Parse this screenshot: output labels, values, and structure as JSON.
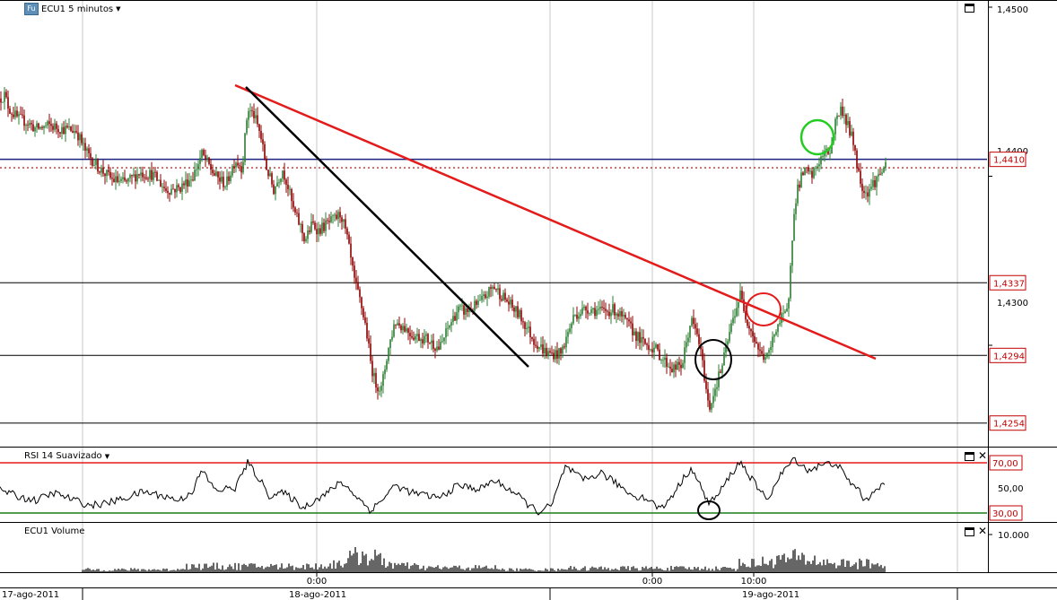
{
  "panels": {
    "price": {
      "title": "ECU1 5 minutos",
      "badge": "Fu"
    },
    "rsi": {
      "title": "RSI 14 Suavizado"
    },
    "volume": {
      "title": "ECU1 Volume"
    }
  },
  "icons": {
    "window": "maximize-icon",
    "close": "close-icon",
    "dropdown": "chevron-down-icon"
  },
  "colors": {
    "up": "#2e7d32",
    "down": "#8b0000",
    "red_line": "#e31b1b",
    "blue_line": "#1a237e",
    "green_line": "#1b7d1b"
  },
  "x_axis": {
    "dates": [
      "17-ago-2011",
      "18-ago-2011",
      "19-ago-2011"
    ],
    "times": [
      "0:00",
      "0:00",
      "10:00"
    ]
  },
  "chart_data": [
    {
      "type": "candlestick",
      "title": "ECU1 5 minutos",
      "ylim": [
        1.421,
        1.4505
      ],
      "y_tick_labels": [
        "1,4500",
        "1,4300",
        "1,4400"
      ],
      "price_levels": [
        {
          "value": 1.441,
          "label": "1,4410",
          "color": "#1a237e"
        },
        {
          "value": 1.4337,
          "label": "1,4337",
          "color": "#000000"
        },
        {
          "value": 1.4294,
          "label": "1,4294",
          "color": "#000000"
        },
        {
          "value": 1.4254,
          "label": "1,4254",
          "color": "#000000"
        }
      ],
      "close_path": [
        [
          0,
          1.4446
        ],
        [
          5,
          1.4448
        ],
        [
          10,
          1.444
        ],
        [
          20,
          1.4434
        ],
        [
          30,
          1.4432
        ],
        [
          40,
          1.4428
        ],
        [
          55,
          1.443
        ],
        [
          70,
          1.4428
        ],
        [
          85,
          1.4427
        ],
        [
          95,
          1.4415
        ],
        [
          110,
          1.4405
        ],
        [
          125,
          1.4398
        ],
        [
          140,
          1.4396
        ],
        [
          155,
          1.4402
        ],
        [
          170,
          1.4401
        ],
        [
          185,
          1.4392
        ],
        [
          200,
          1.4393
        ],
        [
          215,
          1.44
        ],
        [
          225,
          1.4413
        ],
        [
          240,
          1.44
        ],
        [
          252,
          1.4395
        ],
        [
          262,
          1.441
        ],
        [
          270,
          1.4405
        ],
        [
          276,
          1.444
        ],
        [
          283,
          1.4436
        ],
        [
          290,
          1.4425
        ],
        [
          297,
          1.4405
        ],
        [
          305,
          1.4392
        ],
        [
          315,
          1.4404
        ],
        [
          320,
          1.4396
        ],
        [
          327,
          1.438
        ],
        [
          335,
          1.437
        ],
        [
          340,
          1.4362
        ],
        [
          348,
          1.4372
        ],
        [
          355,
          1.4368
        ],
        [
          365,
          1.4372
        ],
        [
          372,
          1.4374
        ],
        [
          380,
          1.4378
        ],
        [
          387,
          1.4363
        ],
        [
          395,
          1.4338
        ],
        [
          402,
          1.4325
        ],
        [
          408,
          1.431
        ],
        [
          413,
          1.429
        ],
        [
          418,
          1.4278
        ],
        [
          425,
          1.4274
        ],
        [
          432,
          1.4296
        ],
        [
          440,
          1.4314
        ],
        [
          450,
          1.4311
        ],
        [
          460,
          1.4306
        ],
        [
          475,
          1.4304
        ],
        [
          490,
          1.4298
        ],
        [
          500,
          1.4311
        ],
        [
          510,
          1.4321
        ],
        [
          520,
          1.432
        ],
        [
          535,
          1.4325
        ],
        [
          550,
          1.4335
        ],
        [
          565,
          1.4326
        ],
        [
          580,
          1.4317
        ],
        [
          595,
          1.4303
        ],
        [
          610,
          1.4295
        ],
        [
          625,
          1.4295
        ],
        [
          640,
          1.4318
        ],
        [
          655,
          1.4322
        ],
        [
          670,
          1.432
        ],
        [
          685,
          1.4321
        ],
        [
          700,
          1.4312
        ],
        [
          715,
          1.4302
        ],
        [
          730,
          1.4298
        ],
        [
          740,
          1.4291
        ],
        [
          750,
          1.4286
        ],
        [
          760,
          1.4288
        ],
        [
          770,
          1.4315
        ],
        [
          778,
          1.4305
        ],
        [
          785,
          1.4282
        ],
        [
          790,
          1.4262
        ],
        [
          797,
          1.4275
        ],
        [
          805,
          1.4288
        ],
        [
          812,
          1.4305
        ],
        [
          818,
          1.4318
        ],
        [
          825,
          1.433
        ],
        [
          832,
          1.4316
        ],
        [
          840,
          1.4305
        ],
        [
          848,
          1.4294
        ],
        [
          856,
          1.4293
        ],
        [
          865,
          1.4311
        ],
        [
          872,
          1.4316
        ],
        [
          878,
          1.432
        ],
        [
          882,
          1.436
        ],
        [
          888,
          1.4392
        ],
        [
          896,
          1.4403
        ],
        [
          905,
          1.44
        ],
        [
          912,
          1.4408
        ],
        [
          918,
          1.4413
        ],
        [
          925,
          1.4415
        ],
        [
          932,
          1.4435
        ],
        [
          938,
          1.444
        ],
        [
          945,
          1.443
        ],
        [
          952,
          1.4418
        ],
        [
          958,
          1.4398
        ],
        [
          965,
          1.439
        ],
        [
          975,
          1.4397
        ],
        [
          985,
          1.4405
        ]
      ]
    },
    {
      "type": "line",
      "title": "RSI 14 Suavizado",
      "ylim": [
        25,
        75
      ],
      "y_tick_labels": [
        "70,00",
        "50,00",
        "30,00"
      ],
      "levels": [
        {
          "value": 70,
          "label": "70,00"
        },
        {
          "value": 30,
          "label": "30,00"
        }
      ],
      "path": [
        [
          0,
          49
        ],
        [
          20,
          43
        ],
        [
          40,
          40
        ],
        [
          60,
          46
        ],
        [
          80,
          41
        ],
        [
          100,
          36
        ],
        [
          120,
          38
        ],
        [
          140,
          42
        ],
        [
          160,
          47
        ],
        [
          180,
          44
        ],
        [
          200,
          40
        ],
        [
          215,
          48
        ],
        [
          225,
          64
        ],
        [
          240,
          48
        ],
        [
          262,
          50
        ],
        [
          276,
          70
        ],
        [
          290,
          56
        ],
        [
          300,
          44
        ],
        [
          315,
          46
        ],
        [
          325,
          42
        ],
        [
          338,
          34
        ],
        [
          350,
          40
        ],
        [
          365,
          46
        ],
        [
          380,
          55
        ],
        [
          395,
          45
        ],
        [
          413,
          32
        ],
        [
          425,
          40
        ],
        [
          440,
          52
        ],
        [
          460,
          46
        ],
        [
          490,
          42
        ],
        [
          510,
          52
        ],
        [
          535,
          49
        ],
        [
          550,
          56
        ],
        [
          570,
          48
        ],
        [
          590,
          36
        ],
        [
          600,
          31
        ],
        [
          615,
          36
        ],
        [
          630,
          67
        ],
        [
          650,
          56
        ],
        [
          670,
          62
        ],
        [
          690,
          52
        ],
        [
          705,
          44
        ],
        [
          720,
          42
        ],
        [
          737,
          33
        ],
        [
          750,
          45
        ],
        [
          770,
          66
        ],
        [
          780,
          52
        ],
        [
          790,
          38
        ],
        [
          800,
          44
        ],
        [
          812,
          58
        ],
        [
          825,
          71
        ],
        [
          835,
          60
        ],
        [
          848,
          46
        ],
        [
          856,
          42
        ],
        [
          870,
          60
        ],
        [
          885,
          74
        ],
        [
          900,
          64
        ],
        [
          915,
          68
        ],
        [
          932,
          70
        ],
        [
          945,
          56
        ],
        [
          958,
          48
        ],
        [
          965,
          38
        ],
        [
          975,
          50
        ],
        [
          985,
          52
        ]
      ]
    },
    {
      "type": "bar",
      "title": "ECU1 Volume",
      "ylim": [
        0,
        12000
      ],
      "y_tick_labels": [
        "10.000"
      ]
    }
  ]
}
